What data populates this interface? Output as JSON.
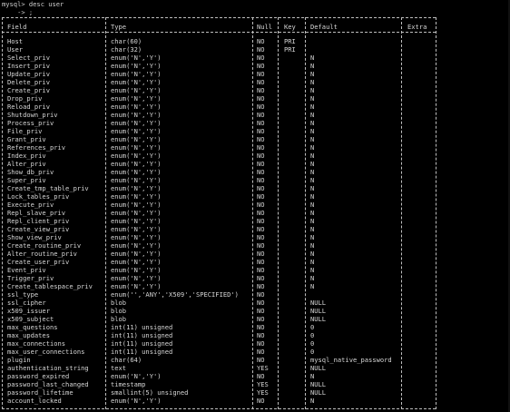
{
  "terminal": {
    "prompt": "mysql> desc user",
    "continuation": "    -> ;",
    "headers": [
      "Field",
      "Type",
      "Null",
      "Key",
      "Default",
      "Extra"
    ],
    "rows": [
      {
        "field": "Host",
        "type": "char(60)",
        "null": "NO",
        "key": "PRI",
        "default": "",
        "extra": ""
      },
      {
        "field": "User",
        "type": "char(32)",
        "null": "NO",
        "key": "PRI",
        "default": "",
        "extra": ""
      },
      {
        "field": "Select_priv",
        "type": "enum('N','Y')",
        "null": "NO",
        "key": "",
        "default": "N",
        "extra": ""
      },
      {
        "field": "Insert_priv",
        "type": "enum('N','Y')",
        "null": "NO",
        "key": "",
        "default": "N",
        "extra": ""
      },
      {
        "field": "Update_priv",
        "type": "enum('N','Y')",
        "null": "NO",
        "key": "",
        "default": "N",
        "extra": ""
      },
      {
        "field": "Delete_priv",
        "type": "enum('N','Y')",
        "null": "NO",
        "key": "",
        "default": "N",
        "extra": ""
      },
      {
        "field": "Create_priv",
        "type": "enum('N','Y')",
        "null": "NO",
        "key": "",
        "default": "N",
        "extra": ""
      },
      {
        "field": "Drop_priv",
        "type": "enum('N','Y')",
        "null": "NO",
        "key": "",
        "default": "N",
        "extra": ""
      },
      {
        "field": "Reload_priv",
        "type": "enum('N','Y')",
        "null": "NO",
        "key": "",
        "default": "N",
        "extra": ""
      },
      {
        "field": "Shutdown_priv",
        "type": "enum('N','Y')",
        "null": "NO",
        "key": "",
        "default": "N",
        "extra": ""
      },
      {
        "field": "Process_priv",
        "type": "enum('N','Y')",
        "null": "NO",
        "key": "",
        "default": "N",
        "extra": ""
      },
      {
        "field": "File_priv",
        "type": "enum('N','Y')",
        "null": "NO",
        "key": "",
        "default": "N",
        "extra": ""
      },
      {
        "field": "Grant_priv",
        "type": "enum('N','Y')",
        "null": "NO",
        "key": "",
        "default": "N",
        "extra": ""
      },
      {
        "field": "References_priv",
        "type": "enum('N','Y')",
        "null": "NO",
        "key": "",
        "default": "N",
        "extra": ""
      },
      {
        "field": "Index_priv",
        "type": "enum('N','Y')",
        "null": "NO",
        "key": "",
        "default": "N",
        "extra": ""
      },
      {
        "field": "Alter_priv",
        "type": "enum('N','Y')",
        "null": "NO",
        "key": "",
        "default": "N",
        "extra": ""
      },
      {
        "field": "Show_db_priv",
        "type": "enum('N','Y')",
        "null": "NO",
        "key": "",
        "default": "N",
        "extra": ""
      },
      {
        "field": "Super_priv",
        "type": "enum('N','Y')",
        "null": "NO",
        "key": "",
        "default": "N",
        "extra": ""
      },
      {
        "field": "Create_tmp_table_priv",
        "type": "enum('N','Y')",
        "null": "NO",
        "key": "",
        "default": "N",
        "extra": ""
      },
      {
        "field": "Lock_tables_priv",
        "type": "enum('N','Y')",
        "null": "NO",
        "key": "",
        "default": "N",
        "extra": ""
      },
      {
        "field": "Execute_priv",
        "type": "enum('N','Y')",
        "null": "NO",
        "key": "",
        "default": "N",
        "extra": ""
      },
      {
        "field": "Repl_slave_priv",
        "type": "enum('N','Y')",
        "null": "NO",
        "key": "",
        "default": "N",
        "extra": ""
      },
      {
        "field": "Repl_client_priv",
        "type": "enum('N','Y')",
        "null": "NO",
        "key": "",
        "default": "N",
        "extra": ""
      },
      {
        "field": "Create_view_priv",
        "type": "enum('N','Y')",
        "null": "NO",
        "key": "",
        "default": "N",
        "extra": ""
      },
      {
        "field": "Show_view_priv",
        "type": "enum('N','Y')",
        "null": "NO",
        "key": "",
        "default": "N",
        "extra": ""
      },
      {
        "field": "Create_routine_priv",
        "type": "enum('N','Y')",
        "null": "NO",
        "key": "",
        "default": "N",
        "extra": ""
      },
      {
        "field": "Alter_routine_priv",
        "type": "enum('N','Y')",
        "null": "NO",
        "key": "",
        "default": "N",
        "extra": ""
      },
      {
        "field": "Create_user_priv",
        "type": "enum('N','Y')",
        "null": "NO",
        "key": "",
        "default": "N",
        "extra": ""
      },
      {
        "field": "Event_priv",
        "type": "enum('N','Y')",
        "null": "NO",
        "key": "",
        "default": "N",
        "extra": ""
      },
      {
        "field": "Trigger_priv",
        "type": "enum('N','Y')",
        "null": "NO",
        "key": "",
        "default": "N",
        "extra": ""
      },
      {
        "field": "Create_tablespace_priv",
        "type": "enum('N','Y')",
        "null": "NO",
        "key": "",
        "default": "N",
        "extra": ""
      },
      {
        "field": "ssl_type",
        "type": "enum('','ANY','X509','SPECIFIED')",
        "null": "NO",
        "key": "",
        "default": "",
        "extra": ""
      },
      {
        "field": "ssl_cipher",
        "type": "blob",
        "null": "NO",
        "key": "",
        "default": "NULL",
        "extra": ""
      },
      {
        "field": "x509_issuer",
        "type": "blob",
        "null": "NO",
        "key": "",
        "default": "NULL",
        "extra": ""
      },
      {
        "field": "x509_subject",
        "type": "blob",
        "null": "NO",
        "key": "",
        "default": "NULL",
        "extra": ""
      },
      {
        "field": "max_questions",
        "type": "int(11) unsigned",
        "null": "NO",
        "key": "",
        "default": "0",
        "extra": ""
      },
      {
        "field": "max_updates",
        "type": "int(11) unsigned",
        "null": "NO",
        "key": "",
        "default": "0",
        "extra": ""
      },
      {
        "field": "max_connections",
        "type": "int(11) unsigned",
        "null": "NO",
        "key": "",
        "default": "0",
        "extra": ""
      },
      {
        "field": "max_user_connections",
        "type": "int(11) unsigned",
        "null": "NO",
        "key": "",
        "default": "0",
        "extra": ""
      },
      {
        "field": "plugin",
        "type": "char(64)",
        "null": "NO",
        "key": "",
        "default": "mysql_native_password",
        "extra": ""
      },
      {
        "field": "authentication_string",
        "type": "text",
        "null": "YES",
        "key": "",
        "default": "NULL",
        "extra": ""
      },
      {
        "field": "password_expired",
        "type": "enum('N','Y')",
        "null": "NO",
        "key": "",
        "default": "N",
        "extra": ""
      },
      {
        "field": "password_last_changed",
        "type": "timestamp",
        "null": "YES",
        "key": "",
        "default": "NULL",
        "extra": ""
      },
      {
        "field": "password_lifetime",
        "type": "smallint(5) unsigned",
        "null": "YES",
        "key": "",
        "default": "NULL",
        "extra": ""
      },
      {
        "field": "account_locked",
        "type": "enum('N','Y')",
        "null": "NO",
        "key": "",
        "default": "N",
        "extra": ""
      }
    ]
  }
}
